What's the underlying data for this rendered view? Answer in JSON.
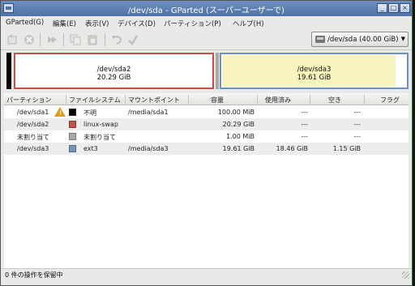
{
  "window": {
    "title": "/dev/sda - GParted (スーパーユーザーで)"
  },
  "menu": [
    {
      "label": "GParted(G)"
    },
    {
      "label": "編集(E)"
    },
    {
      "label": "表示(V)"
    },
    {
      "label": "デバイス(D)"
    },
    {
      "label": "パーティション(P)"
    },
    {
      "label": "ヘルプ(H)"
    }
  ],
  "toolbar": {
    "icons": [
      "new-icon",
      "delete-icon",
      "resize-move-icon",
      "copy-icon",
      "paste-icon",
      "undo-icon",
      "apply-icon"
    ],
    "device_selector": "/dev/sda  (40.00 GiB)"
  },
  "partition_graph": [
    {
      "name": "/dev/sda2",
      "size": "20.29 GiB",
      "color": "#c4514a"
    },
    {
      "name": "/dev/sda3",
      "size": "19.61 GiB",
      "color": "#6f8fbf"
    }
  ],
  "table": {
    "columns": [
      "パーティション",
      "ファイルシステム",
      "マウントポイント",
      "容量",
      "使用済み",
      "空き",
      "フラグ"
    ],
    "rows": [
      {
        "partition": "/dev/sda1",
        "warning": true,
        "fs_color": "#000000",
        "filesystem": "不明",
        "mount": "/media/sda1",
        "size": "100.00 MiB",
        "used": "---",
        "free": "---",
        "flags": ""
      },
      {
        "partition": "/dev/sda2",
        "warning": false,
        "fs_color": "#c4514a",
        "filesystem": "linux-swap",
        "mount": "",
        "size": "20.29 GiB",
        "used": "---",
        "free": "---",
        "flags": ""
      },
      {
        "partition": "未割り当て",
        "warning": false,
        "fs_color": "#a9a9a9",
        "filesystem": "未割り当て",
        "mount": "",
        "size": "1.00 MiB",
        "used": "---",
        "free": "---",
        "flags": ""
      },
      {
        "partition": "/dev/sda3",
        "warning": false,
        "fs_color": "#7a94b8",
        "filesystem": "ext3",
        "mount": "/media/sda3",
        "size": "19.61 GiB",
        "used": "18.46 GiB",
        "free": "1.15 GiB",
        "flags": ""
      }
    ]
  },
  "status": {
    "text": "0 件の操作を保留中"
  },
  "colors": {
    "titlebar": "#5a7db3",
    "unused_fill": "#f7f4bd"
  }
}
